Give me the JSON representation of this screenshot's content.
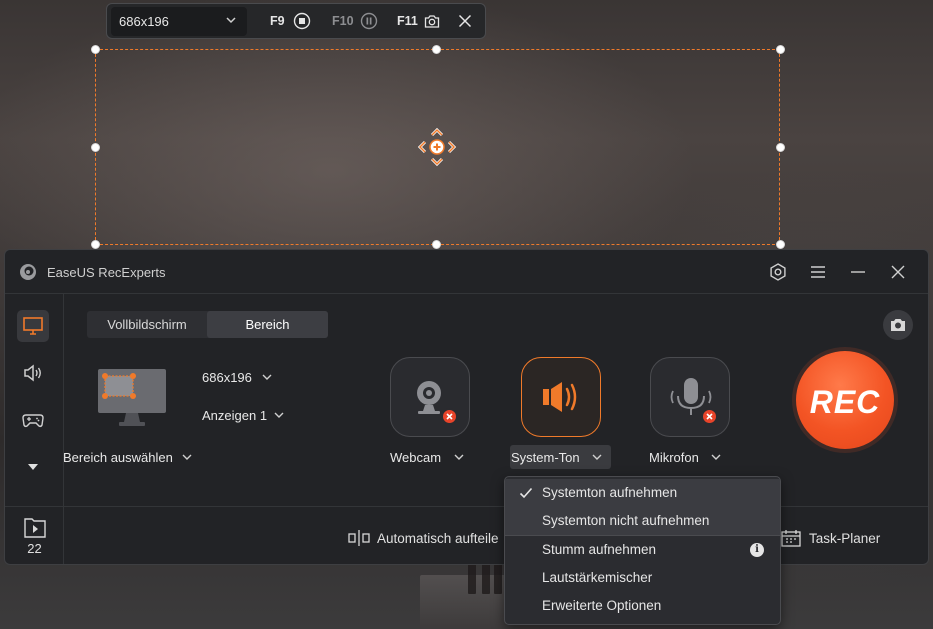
{
  "toolbar": {
    "size_value": "686x196",
    "hotkeys": [
      {
        "key": "F9",
        "icon": "stop-icon"
      },
      {
        "key": "F10",
        "icon": "pause-icon"
      },
      {
        "key": "F11",
        "icon": "camera-icon"
      }
    ],
    "close_icon": "close-icon"
  },
  "window": {
    "title": "EaseUS RecExperts",
    "icons": [
      "settings-icon",
      "menu-icon",
      "minimize-icon",
      "close-icon"
    ]
  },
  "sidebar": {
    "items": [
      "screen-icon",
      "audio-icon",
      "game-icon",
      "more-down-icon"
    ],
    "recordings_count": "22"
  },
  "tabs": [
    {
      "label": "Vollbildschirm",
      "active": false
    },
    {
      "label": "Bereich",
      "active": true
    }
  ],
  "region": {
    "size": "686x196",
    "display": "Anzeigen 1",
    "select_label": "Bereich auswählen"
  },
  "sources": {
    "webcam_label": "Webcam",
    "system_label": "System-Ton",
    "mic_label": "Mikrofon"
  },
  "rec_label": "REC",
  "bottom": {
    "auto_split": "Automatisch aufteile",
    "task_planer": "Task-Planer"
  },
  "menu": {
    "items": [
      {
        "label": "Systemton aufnehmen",
        "checked": true
      },
      {
        "label": "Systemton nicht aufnehmen",
        "checked": false
      },
      {
        "label": "Stumm aufnehmen",
        "checked": false
      },
      {
        "label": "Lautstärkemischer",
        "checked": false
      },
      {
        "label": "Erweiterte Optionen",
        "checked": false
      }
    ]
  },
  "colors": {
    "accent": "#f07a2a",
    "rec": "#f35424",
    "window_bg": "#222326",
    "badge_red": "#e8442a"
  }
}
